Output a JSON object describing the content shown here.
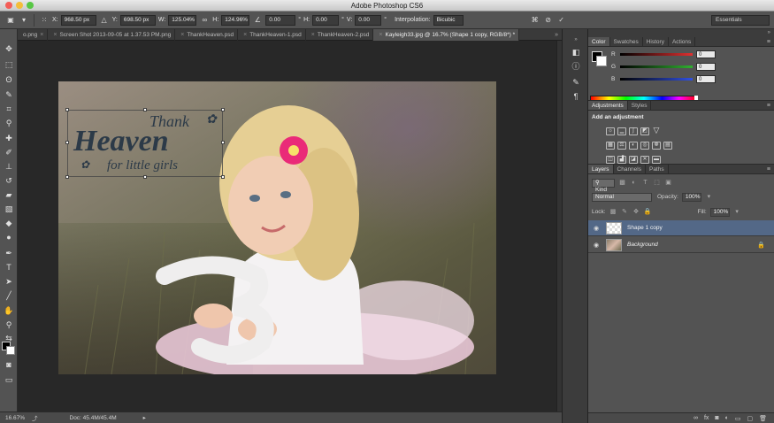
{
  "app": {
    "title": "Adobe Photoshop CS6"
  },
  "window_controls": [
    {
      "name": "close",
      "color": "#f35e58"
    },
    {
      "name": "minimize",
      "color": "#f4bd3a"
    },
    {
      "name": "zoom",
      "color": "#58c745"
    }
  ],
  "options_bar": {
    "x_label": "X:",
    "x_value": "968.50 px",
    "y_label": "Y:",
    "y_value": "698.50 px",
    "w_label": "W:",
    "w_value": "125.04%",
    "h_label": "H:",
    "h_value": "124.96%",
    "angle_value": "0.00",
    "hskew_label": "H:",
    "hskew_value": "0.00",
    "vskew_label": "V:",
    "vskew_value": "0.00",
    "interp_label": "Interpolation:",
    "interp_value": "Bicubic",
    "workspace": "Essentials"
  },
  "doc_tabs": [
    {
      "label": "o.png",
      "active": false
    },
    {
      "label": "Screen Shot 2013-09-05 at 1.37.53 PM.png",
      "active": false
    },
    {
      "label": "ThankHeaven.psd",
      "active": false
    },
    {
      "label": "ThankHeaven-1.psd",
      "active": false
    },
    {
      "label": "ThankHeaven-2.psd",
      "active": false
    },
    {
      "label": "Kayleigh33.jpg @ 16.7% (Shape 1 copy, RGB/8*) *",
      "active": true
    }
  ],
  "overlay_text": {
    "line1": "Thank",
    "line2": "Heaven",
    "line3": "for little girls"
  },
  "status_bar": {
    "zoom": "16.67%",
    "doc": "Doc: 45.4M/45.4M"
  },
  "color_panel": {
    "tabs": [
      "Color",
      "Swatches",
      "History",
      "Actions"
    ],
    "channels": [
      {
        "label": "R",
        "value": "0",
        "color": "#e03030"
      },
      {
        "label": "G",
        "value": "0",
        "color": "#30b030"
      },
      {
        "label": "B",
        "value": "0",
        "color": "#3050e0"
      }
    ]
  },
  "adjustments_panel": {
    "tabs": [
      "Adjustments",
      "Styles"
    ],
    "heading": "Add an adjustment"
  },
  "layers_panel": {
    "tabs": [
      "Layers",
      "Channels",
      "Paths"
    ],
    "kind_label": "Kind",
    "blend_mode": "Normal",
    "opacity_label": "Opacity:",
    "opacity_value": "100%",
    "lock_label": "Lock:",
    "fill_label": "Fill:",
    "fill_value": "100%",
    "layers": [
      {
        "name": "Shape 1 copy",
        "selected": true
      },
      {
        "name": "Background",
        "selected": false
      }
    ]
  }
}
